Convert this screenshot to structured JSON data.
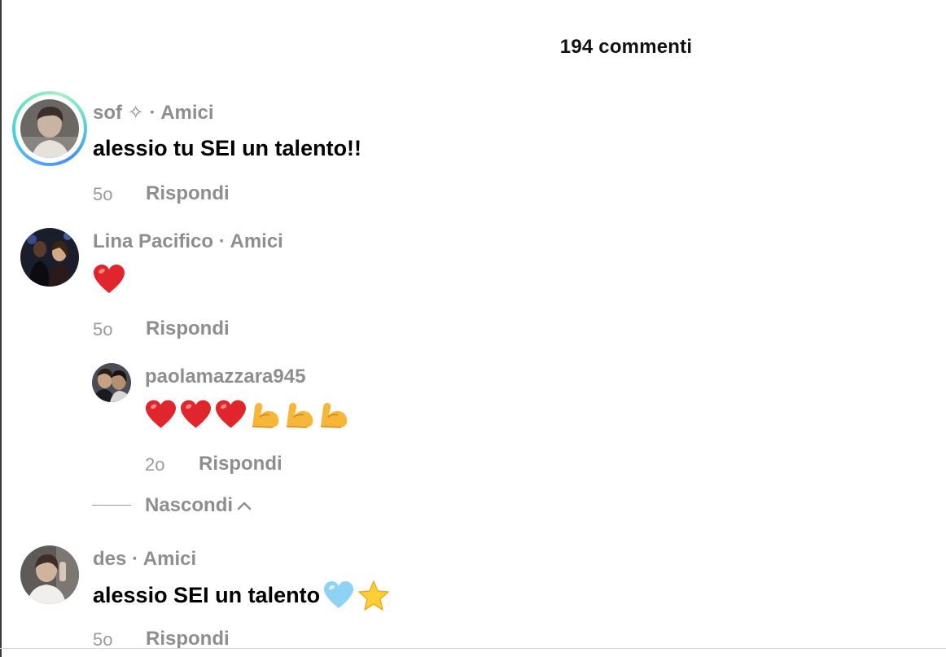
{
  "header": {
    "title": "194 commenti"
  },
  "comments": [
    {
      "username": "sof ✧ · Amici",
      "text": "alessio tu SEI un talento!!",
      "time": "5o",
      "reply_label": "Rispondi"
    },
    {
      "username": "Lina Pacifico · Amici",
      "text": "❤️",
      "time": "5o",
      "reply_label": "Rispondi",
      "replies": [
        {
          "username": "paolamazzara945",
          "text": "❤️❤️❤️💪💪💪",
          "time": "2o",
          "reply_label": "Rispondi"
        }
      ],
      "hide_label": "Nascondi"
    },
    {
      "username": "des · Amici",
      "text": "alessio SEI un talento",
      "text_emojis": "🩵⭐",
      "time": "5o",
      "reply_label": "Rispondi"
    }
  ],
  "icons": {
    "heart": "heart-icon",
    "flexed-biceps": "flexed-biceps-icon",
    "light-blue-heart": "light-blue-heart-icon",
    "star": "star-icon",
    "chevron-up": "chevron-up-icon"
  },
  "colors": {
    "meta": "#8e8e8e",
    "text": "#000000",
    "heart": "#e0262c",
    "story_ring_start": "#5aa3ff",
    "story_ring_end": "#72e6b8"
  }
}
